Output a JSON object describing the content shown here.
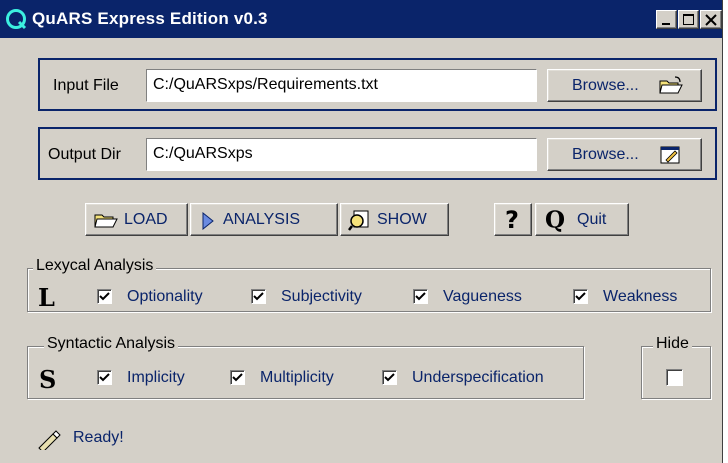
{
  "window": {
    "title": "QuARS Express Edition v0.3"
  },
  "input": {
    "label": "Input File",
    "value": "C:/QuARSxps/Requirements.txt",
    "browse_label": "Browse..."
  },
  "output": {
    "label": "Output Dir",
    "value": "C:/QuARSxps",
    "browse_label": "Browse..."
  },
  "toolbar": {
    "load_label": "LOAD",
    "analysis_label": "ANALYSIS",
    "show_label": "SHOW",
    "help_glyph": "?",
    "quit_glyph": "Q",
    "quit_label": "Quit"
  },
  "lexical": {
    "title": "Lexycal Analysis",
    "glyph": "L",
    "items": [
      {
        "label": "Optionality",
        "checked": true
      },
      {
        "label": "Subjectivity",
        "checked": true
      },
      {
        "label": "Vagueness",
        "checked": true
      },
      {
        "label": "Weakness",
        "checked": true
      }
    ]
  },
  "syntactic": {
    "title": "Syntactic Analysis",
    "glyph": "S",
    "items": [
      {
        "label": "Implicity",
        "checked": true
      },
      {
        "label": "Multiplicity",
        "checked": true
      },
      {
        "label": "Underspecification",
        "checked": true
      }
    ]
  },
  "hide": {
    "title": "Hide",
    "checked": false
  },
  "status": {
    "text": "Ready!",
    "icon": "pencil-icon"
  },
  "colors": {
    "titlebar": "#0a246a",
    "face": "#d4d0c8",
    "accent_text": "#0a246a"
  }
}
